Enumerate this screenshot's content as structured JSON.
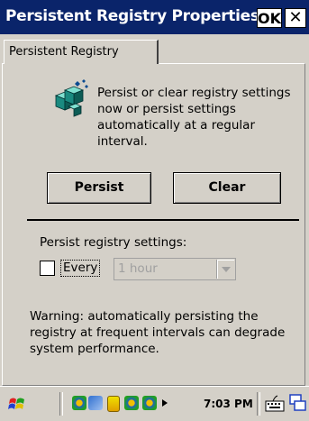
{
  "window": {
    "title": "Persistent Registry Properties",
    "ok_label": "OK",
    "close_label": "✕"
  },
  "tabs": [
    {
      "label": "Persistent Registry",
      "active": true
    }
  ],
  "main": {
    "icon": "registry-icon",
    "description": "Persist or clear registry settings now or persist settings automatically at a regular interval.",
    "persist_button": "Persist",
    "clear_button": "Clear",
    "settings_label": "Persist registry settings:",
    "every_label": "Every",
    "every_checked": false,
    "interval_value": "1 hour",
    "interval_enabled": false,
    "warning": "Warning: automatically persisting the registry at frequent intervals can degrade system performance."
  },
  "taskbar": {
    "clock": "7:03 PM",
    "icons": [
      "start-flag-icon",
      "network-icon",
      "connection-icon",
      "battery-icon",
      "sync-icon",
      "sync-icon-2",
      "arrow-icon",
      "keyboard-icon",
      "desktop-icon"
    ]
  },
  "colors": {
    "titlebar": "#0a246a",
    "window_bg": "#d4d0c8"
  }
}
